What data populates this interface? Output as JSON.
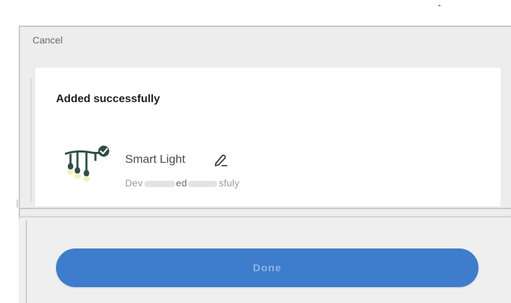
{
  "header": {
    "cancel_label": "Cancel"
  },
  "result": {
    "title": "Added successfully"
  },
  "device": {
    "name": "Smart Light",
    "icon": "string-lights-icon",
    "status_prefix": "Dev",
    "status_mid": "ed",
    "status_suffix": "sfuly"
  },
  "footer": {
    "done_label": "Done"
  },
  "colors": {
    "accent": "#3d7dcc",
    "panel": "#ededed",
    "card": "#ffffff",
    "title_text": "#1f1f1f",
    "muted_text": "#9a9a9a"
  }
}
